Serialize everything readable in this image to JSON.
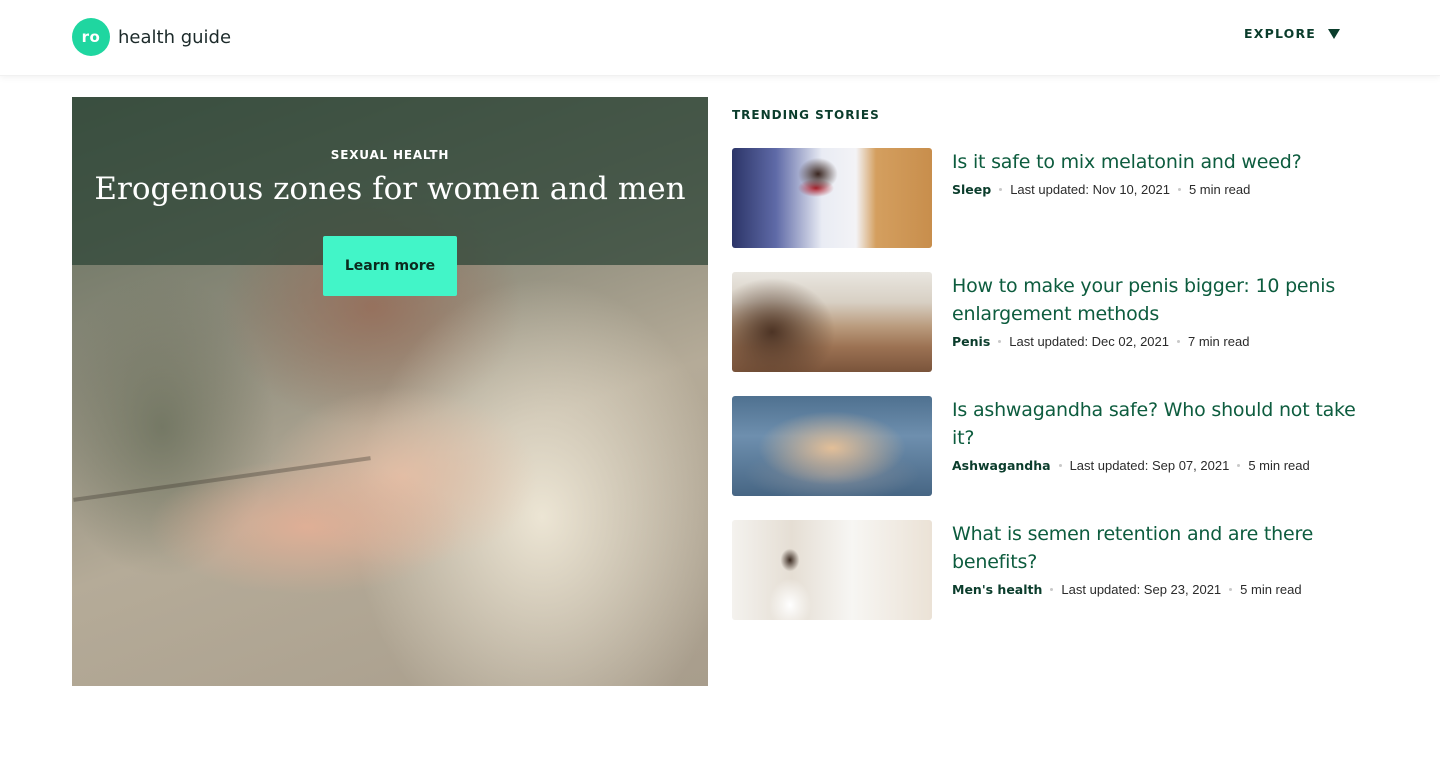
{
  "header": {
    "logo_badge": "ro",
    "logo_text": "health guide",
    "explore_label": "EXPLORE"
  },
  "hero": {
    "eyebrow": "SEXUAL HEALTH",
    "title": "Erogenous zones for women and men",
    "button_label": "Learn more"
  },
  "trending": {
    "title": "TRENDING STORIES",
    "stories": [
      {
        "title": "Is it safe to mix melatonin and weed?",
        "category": "Sleep",
        "updated": "Last updated: Nov 10, 2021",
        "read_time": "5 min read"
      },
      {
        "title": "How to make your penis bigger: 10 penis enlargement methods",
        "category": "Penis",
        "updated": "Last updated: Dec 02, 2021",
        "read_time": "7 min read"
      },
      {
        "title": "Is ashwagandha safe? Who should not take it?",
        "category": "Ashwagandha",
        "updated": "Last updated: Sep 07, 2021",
        "read_time": "5 min read"
      },
      {
        "title": "What is semen retention and are there benefits?",
        "category": "Men's health",
        "updated": "Last updated: Sep 23, 2021",
        "read_time": "5 min read"
      }
    ]
  },
  "colors": {
    "brand_green": "#1fd6a0",
    "accent_mint": "#42f5c8",
    "title_green": "#0d5c3e",
    "dark_green": "#0b3d2c"
  }
}
